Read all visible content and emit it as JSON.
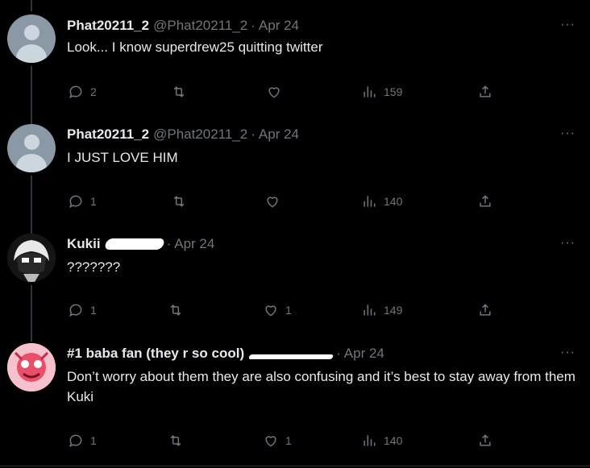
{
  "tweets": [
    {
      "name": "Phat20211_2",
      "handle": "@Phat20211_2",
      "date": "Apr 24",
      "text": "Look... I know superdrew25 quitting twitter",
      "replies": "2",
      "retweets": "",
      "likes": "",
      "views": "159",
      "avatar": "default-avatar"
    },
    {
      "name": "Phat20211_2",
      "handle": "@Phat20211_2",
      "date": "Apr 24",
      "text": "I JUST LOVE HIM",
      "replies": "1",
      "retweets": "",
      "likes": "",
      "views": "140",
      "avatar": "default-avatar"
    },
    {
      "name": "Kukii",
      "handle": "",
      "date": "Apr 24",
      "text": "???????",
      "replies": "1",
      "retweets": "",
      "likes": "1",
      "views": "149",
      "avatar": "anime-character-avatar"
    },
    {
      "name": "#1 baba fan (they r so cool)",
      "handle": "",
      "date": "Apr 24",
      "text": "Don’t worry about them they are also confusing and it’s best to stay away from them Kuki",
      "replies": "1",
      "retweets": "",
      "likes": "1",
      "views": "140",
      "avatar": "pink-character-avatar"
    }
  ],
  "ui": {
    "separator": "·",
    "more": "···"
  },
  "colors": {
    "background": "#000000",
    "text": "#e7e9ea",
    "muted": "#71767b",
    "thread_line": "#333639"
  },
  "icons": [
    "reply-icon",
    "retweet-icon",
    "like-icon",
    "views-icon",
    "share-icon",
    "more-icon"
  ]
}
